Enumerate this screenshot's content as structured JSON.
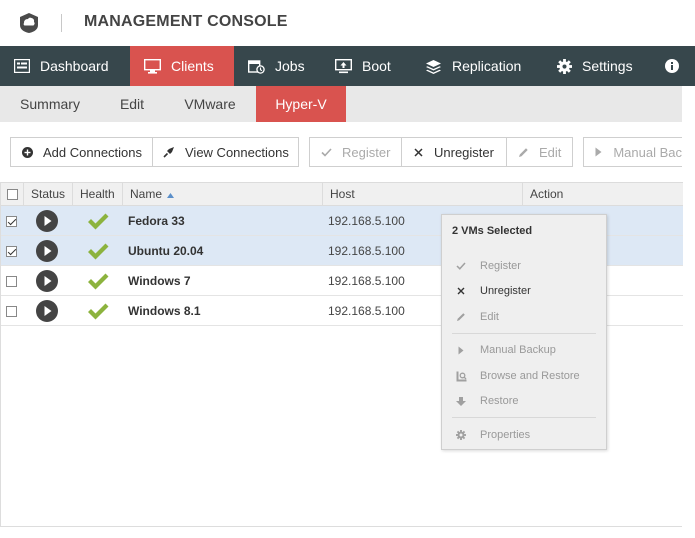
{
  "header": {
    "title": "MANAGEMENT CONSOLE"
  },
  "nav": [
    {
      "label": "Dashboard",
      "icon": "dashboard-icon"
    },
    {
      "label": "Clients",
      "icon": "monitor-icon",
      "active": true
    },
    {
      "label": "Jobs",
      "icon": "jobs-icon"
    },
    {
      "label": "Boot",
      "icon": "boot-icon"
    },
    {
      "label": "Replication",
      "icon": "layers-icon"
    },
    {
      "label": "Settings",
      "icon": "gear-icon"
    }
  ],
  "subnav": [
    {
      "label": "Summary"
    },
    {
      "label": "Edit"
    },
    {
      "label": "VMware"
    },
    {
      "label": "Hyper-V",
      "active": true
    }
  ],
  "toolbar": {
    "add_connections": "Add Connections",
    "view_connections": "View Connections",
    "register": "Register",
    "unregister": "Unregister",
    "edit": "Edit",
    "manual_backup": "Manual Bac"
  },
  "grid": {
    "columns": [
      "Status",
      "Health",
      "Name",
      "Host",
      "Action"
    ],
    "rows": [
      {
        "name": "Fedora 33",
        "host": "192.168.5.100",
        "checked": true
      },
      {
        "name": "Ubuntu 20.04",
        "host": "192.168.5.100",
        "checked": true
      },
      {
        "name": "Windows 7",
        "host": "192.168.5.100",
        "checked": false
      },
      {
        "name": "Windows 8.1",
        "host": "192.168.5.100",
        "checked": false
      }
    ]
  },
  "context_menu": {
    "title": "2 VMs Selected",
    "items": [
      {
        "label": "Register",
        "icon": "check-icon",
        "enabled": false
      },
      {
        "label": "Unregister",
        "icon": "x-icon",
        "enabled": true
      },
      {
        "label": "Edit",
        "icon": "pencil-icon",
        "enabled": false
      },
      {
        "label": "Manual Backup",
        "icon": "play-icon",
        "enabled": false
      },
      {
        "label": "Browse and Restore",
        "icon": "browse-icon",
        "enabled": false
      },
      {
        "label": "Restore",
        "icon": "restore-arrow-icon",
        "enabled": false
      },
      {
        "label": "Properties",
        "icon": "gear-icon",
        "enabled": false
      }
    ]
  },
  "colors": {
    "navbar": "#37474c",
    "accent": "#d9534f",
    "selected_row": "#dde8f5",
    "health_check": "#8cb33e"
  }
}
